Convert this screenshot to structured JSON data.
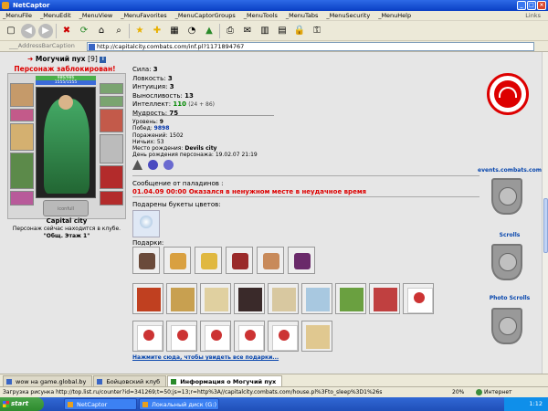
{
  "window": {
    "title": "NetCaptor"
  },
  "menu": [
    "_MenuFile",
    "_MenuEdit",
    "_MenuView",
    "_MenuFavorites",
    "_MenuCaptorGroups",
    "_MenuTools",
    "_MenuTabs",
    "_MenuSecurity",
    "_MenuHelp"
  ],
  "menu_links": "Links",
  "address": {
    "label": "___AddressBarCaption",
    "url": "http://capitalcity.combats.com/inf.pl?1171894767"
  },
  "character": {
    "arrow": "➜",
    "name": "Могучий пух",
    "level": "[9]",
    "blocked": "Персонаж заблокирован!",
    "hp": "986/986",
    "mp": "1555/1555",
    "clan_icon": "iconfull",
    "city": "Capital city",
    "location_text": "Персонаж сейчас находится в клубе.",
    "room": "\"Общ. Этаж 1\""
  },
  "stats": [
    {
      "label": "Сила:",
      "value": "3"
    },
    {
      "label": "Ловкость:",
      "value": "3"
    },
    {
      "label": "Интуиция:",
      "value": "3"
    },
    {
      "label": "Выносливость:",
      "value": "13"
    },
    {
      "label": "Интеллект:",
      "value": "110",
      "extra": "(24 + 86)"
    },
    {
      "label": "Мудрость:",
      "value": "75"
    }
  ],
  "info": {
    "level_label": "Уровень:",
    "level": "9",
    "wins_label": "Побед:",
    "wins": "9898",
    "losses_label": "Поражений:",
    "losses": "1502",
    "draws_label": "Ничьих:",
    "draws": "53",
    "birthplace_label": "Место рождения:",
    "birthplace": "Devils city",
    "birthday_label": "День рождения персонажа:",
    "birthday": "19.02.07 21:19"
  },
  "paladin_message": {
    "label": "Сообщение от паладинов :",
    "text": "01.04.09 00:00 Оказался в ненужном месте в неудачное время"
  },
  "bouquets_label": "Подарены букеты цветов:",
  "gifts_label": "Подарки:",
  "see_all": "Нажмите сюда, чтобы увидеть все подарки...",
  "right_links": [
    "events.combats.com",
    "Scrolls",
    "Photo Scrolls"
  ],
  "tabs": [
    "wow на game.global.by",
    "Бойцовский клуб",
    "Информация о Могучий пух"
  ],
  "status": {
    "text": "Загрузка рисунка http://top.list.ru/counter?id=341269;t=50;js=13;r=http%3A//capitalcity.combats.com/house.pl%3Fto_sleep%3D1%26s",
    "zoom": "20%",
    "zone": "Интернет"
  },
  "taskbar": {
    "start": "start",
    "tasks": [
      "NetCaptor",
      "Локальный диск (G:)"
    ],
    "time": "1:12"
  },
  "colors": {
    "accent_red": "#d00000",
    "link_blue": "#0645ad",
    "stat_green": "#008800"
  }
}
